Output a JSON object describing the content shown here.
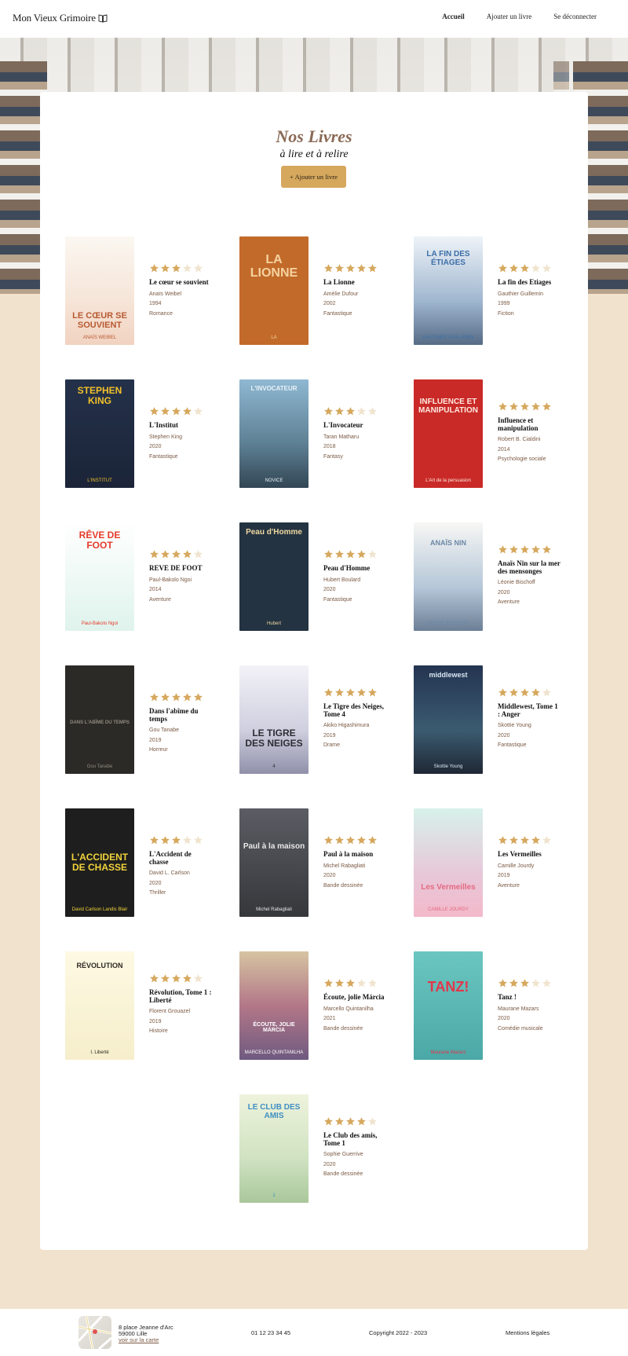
{
  "header": {
    "logo_text": "Mon Vieux Grimoire",
    "nav": [
      "Accueil",
      "Ajouter un livre",
      "Se déconnecter"
    ]
  },
  "main": {
    "title": "Nos Livres",
    "subtitle": "à lire et à relire",
    "add_button": "+ Ajouter un livre"
  },
  "books": [
    {
      "title": "Le cœur se souvient",
      "author": "Anaïs Weibel",
      "year": "1994",
      "genre": "Romance",
      "rating": 3,
      "cover_title": "LE CŒUR SE SOUVIENT",
      "cover_author": "ANAÏS WEIBEL"
    },
    {
      "title": "La Lionne",
      "author": "Amélie Dufour",
      "year": "2002",
      "genre": "Fantastique",
      "rating": 5,
      "cover_title": "LA LIONNE",
      "cover_author": "LA"
    },
    {
      "title": "La fin des Etiages",
      "author": "Gauthier Guillemin",
      "year": "1999",
      "genre": "Fiction",
      "rating": 3,
      "cover_title": "LA FIN DES ÉTIAGES",
      "cover_author": "GAUTHIER GUILLEMIN"
    },
    {
      "title": "L'Institut",
      "author": "Stephen King",
      "year": "2020",
      "genre": "Fantastique",
      "rating": 4,
      "cover_title": "STEPHEN KING",
      "cover_author": "L'INSTITUT"
    },
    {
      "title": "L'Invocateur",
      "author": "Taran Matharu",
      "year": "2018",
      "genre": "Fantasy",
      "rating": 3,
      "cover_title": "L'INVOCATEUR",
      "cover_author": "NOVICE"
    },
    {
      "title": "Influence et manipulation",
      "author": "Robert B. Cialdini",
      "year": "2014",
      "genre": "Psychologie sociale",
      "rating": 5,
      "cover_title": "INFLUENCE ET MANIPULATION",
      "cover_author": "L'Art de la persuasion"
    },
    {
      "title": "REVE DE FOOT",
      "author": "Paul-Bakolo Ngoi",
      "year": "2014",
      "genre": "Aventure",
      "rating": 4,
      "cover_title": "RÊVE DE FOOT",
      "cover_author": "Paul-Bakolo Ngoi"
    },
    {
      "title": "Peau d'Homme",
      "author": "Hubert Boulard",
      "year": "2020",
      "genre": "Fantastique",
      "rating": 4,
      "cover_title": "Peau d'Homme",
      "cover_author": "Hubert"
    },
    {
      "title": "Anaïs Nin sur la mer des mensonges",
      "author": "Léonie Bischoff",
      "year": "2020",
      "genre": "Aventure",
      "rating": 5,
      "cover_title": "ANAÏS NIN",
      "cover_author": "LÉONIE BISCHOFF"
    },
    {
      "title": "Dans l'abîme du temps",
      "author": "Gou Tanabe",
      "year": "2019",
      "genre": "Horreur",
      "rating": 5,
      "cover_title": "DANS L'ABÎME DU TEMPS",
      "cover_author": "Gou Tanabe"
    },
    {
      "title": "Le Tigre des Neiges, Tome 4",
      "author": "Akiko Higashimura",
      "year": "2019",
      "genre": "Drame",
      "rating": 5,
      "cover_title": "LE TIGRE DES NEIGES",
      "cover_author": "4"
    },
    {
      "title": "Middlewest, Tome 1 : Anger",
      "author": "Skottie Young",
      "year": "2020",
      "genre": "Fantastique",
      "rating": 4,
      "cover_title": "middlewest",
      "cover_author": "Skottie Young"
    },
    {
      "title": "L'Accident de chasse",
      "author": "David L. Carlson",
      "year": "2020",
      "genre": "Thriller",
      "rating": 3,
      "cover_title": "L'ACCIDENT DE CHASSE",
      "cover_author": "David Carlson  Landis Blair"
    },
    {
      "title": "Paul à la maison",
      "author": "Michel Rabagliati",
      "year": "2020",
      "genre": "Bande dessinée",
      "rating": 5,
      "cover_title": "Paul à la maison",
      "cover_author": "Michel Rabagliati"
    },
    {
      "title": "Les Vermeilles",
      "author": "Camille Jourdy",
      "year": "2019",
      "genre": "Aventure",
      "rating": 4,
      "cover_title": "Les Vermeilles",
      "cover_author": "CAMILLE JOURDY"
    },
    {
      "title": "Révolution, Tome 1 : Liberté",
      "author": "Florent Grouazel",
      "year": "2019",
      "genre": "Histoire",
      "rating": 4,
      "cover_title": "RÉVOLUTION",
      "cover_author": "I. Liberté"
    },
    {
      "title": "Écoute, jolie Márcia",
      "author": "Marcello Quintanilha",
      "year": "2021",
      "genre": "Bande dessinée",
      "rating": 3,
      "cover_title": "ÉCOUTE, JOLIE MÁRCIA",
      "cover_author": "MARCELLO QUINTANILHA"
    },
    {
      "title": "Tanz !",
      "author": "Maurane Mazars",
      "year": "2020",
      "genre": "Comédie musicale",
      "rating": 3,
      "cover_title": "TANZ!",
      "cover_author": "Maurane Mazars"
    },
    {
      "title": "Le Club des amis, Tome 1",
      "author": "Sophie Guerrive",
      "year": "2020",
      "genre": "Bande dessinée",
      "rating": 4,
      "cover_title": "LE CLUB DES AMIS",
      "cover_author": "1"
    }
  ],
  "footer": {
    "address_line1": "8 place Jeanne d'Arc",
    "address_line2": "59000 Lille",
    "map_link": "voir sur la carte",
    "phone": "01 12 23 34 45",
    "copyright": "Copyright 2022 - 2023",
    "legal": "Mentions légales"
  },
  "colors": {
    "star_filled": "#d6a85e",
    "star_empty": "#f0e4cf",
    "accent": "#d6a85e",
    "page_background": "#f1e2cd",
    "meta_text": "#7b5a44"
  }
}
